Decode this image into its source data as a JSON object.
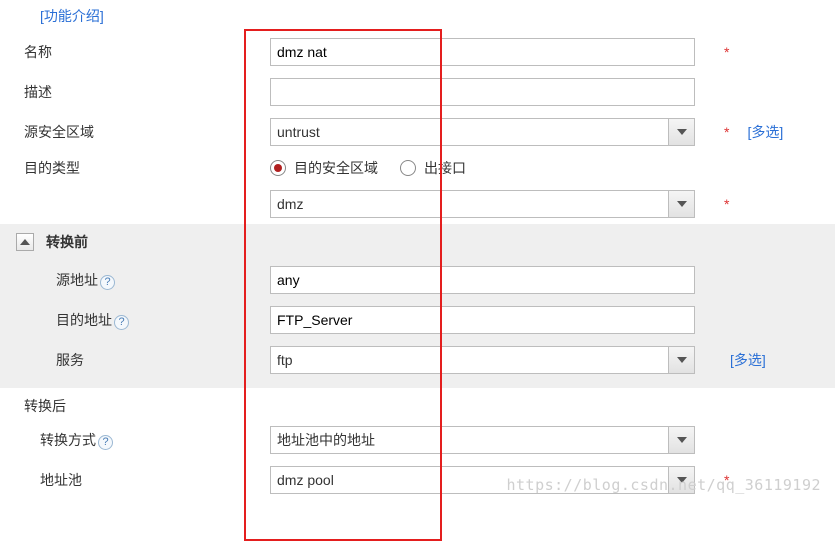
{
  "topLink": "[功能介绍]",
  "labels": {
    "name": "名称",
    "desc": "描述",
    "srcZone": "源安全区域",
    "destType": "目的类型",
    "beforeConv": "转换前",
    "srcAddr": "源地址",
    "destAddr": "目的地址",
    "service": "服务",
    "afterConv": "转换后",
    "convMode": "转换方式",
    "addrPool": "地址池"
  },
  "values": {
    "name": "dmz nat",
    "desc": "",
    "srcZone": "untrust",
    "destZoneSel": "dmz",
    "srcAddr": "any",
    "destAddr": "FTP_Server",
    "service": "ftp",
    "convMode": "地址池中的地址",
    "addrPool": "dmz pool"
  },
  "radios": {
    "destZone": "目的安全区域",
    "outIf": "出接口"
  },
  "marks": {
    "required": "*",
    "multi": "[多选]",
    "help": "?"
  },
  "watermark": "https://blog.csdn.net/qq_36119192"
}
